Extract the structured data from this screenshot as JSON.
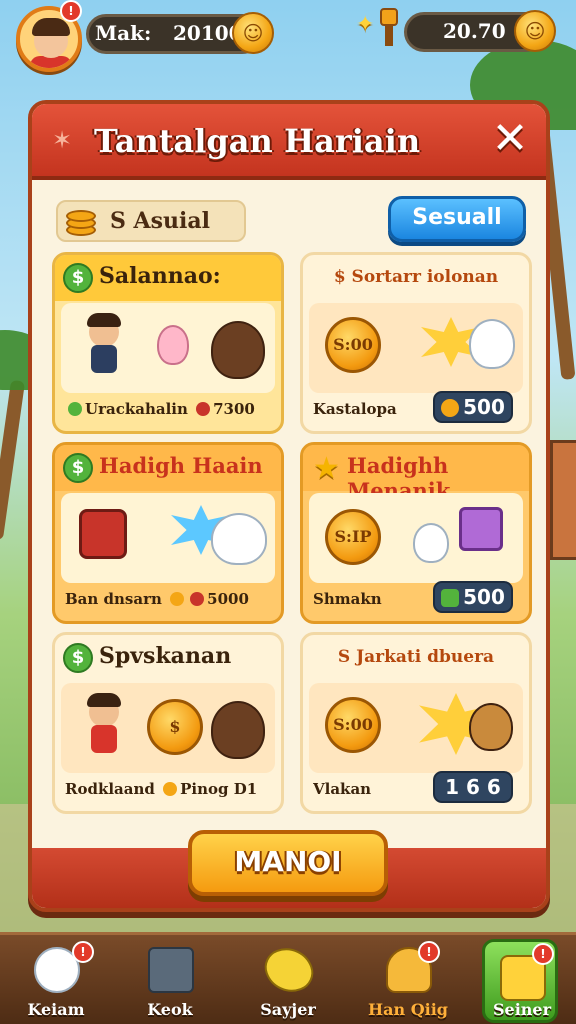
{
  "topbar": {
    "player_label": "Mak:",
    "coins_left": "20100",
    "coins_right": "20.70",
    "avatar_badge": "!"
  },
  "panel": {
    "title": "Tantalgan Hariain",
    "close_symbol": "✕",
    "status_label": "S Asuial",
    "action_button": "Sesuall",
    "main_button": "MANOI"
  },
  "cards": [
    {
      "title": "Salannao:",
      "footer_left": "Urackahalin",
      "footer_right": "7300"
    },
    {
      "title": "$ Sortarr iolonan",
      "footer_left": "Kastalopa",
      "reward": "500",
      "coin_label": "S:00"
    },
    {
      "title": "Hadigh Haain",
      "footer_left": "Ban dnsarn",
      "footer_right": "5000"
    },
    {
      "title": "Hadighh Menanik",
      "footer_left": "Shmakn",
      "reward": "500",
      "coin_label": "S:IP"
    },
    {
      "title": "Spvskanan",
      "footer_left": "Rodklaand",
      "footer_right": "Pinog D1"
    },
    {
      "title": "S Jarkati dbuera",
      "footer_left": "Vlakan",
      "reward": "1 6 6",
      "coin_label": "S:00"
    }
  ],
  "nav": [
    {
      "label": "Keiam",
      "icon": "mascot-icon"
    },
    {
      "label": "Keok",
      "icon": "calculator-icon"
    },
    {
      "label": "Sayjer",
      "icon": "banana-icon"
    },
    {
      "label": "Han Qiig",
      "icon": "bell-mascot-icon"
    },
    {
      "label": "Seiner",
      "icon": "store-icon"
    }
  ],
  "colors": {
    "header_red": "#c4341f",
    "accent_gold": "#f59b10",
    "button_blue": "#1b86e0",
    "nav_brown": "#4e2c14"
  }
}
